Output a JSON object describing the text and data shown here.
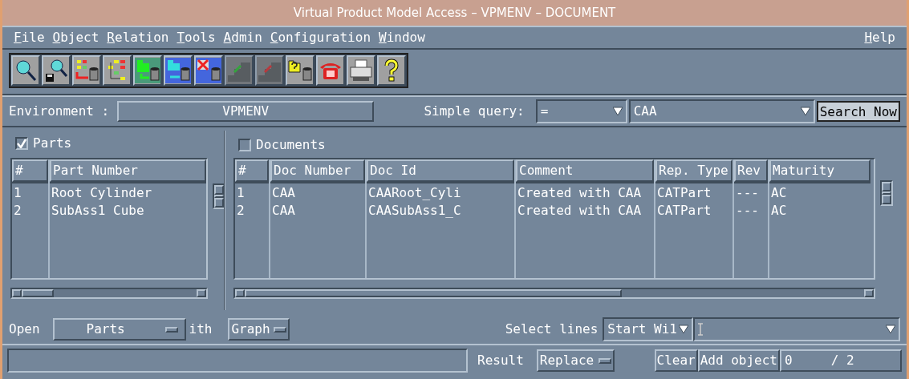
{
  "window": {
    "title": "Virtual Product Model Access – VPMENV – DOCUMENT"
  },
  "menu": [
    {
      "label": "File"
    },
    {
      "label": "Object"
    },
    {
      "label": "Relation"
    },
    {
      "label": "Tools"
    },
    {
      "label": "Admin"
    },
    {
      "label": "Configuration"
    },
    {
      "label": "Window"
    }
  ],
  "help_menu": {
    "label": "Help"
  },
  "toolbar": [
    {
      "kind": "search",
      "disabled": false
    },
    {
      "kind": "search-save",
      "disabled": false
    },
    {
      "kind": "tree-db",
      "disabled": false
    },
    {
      "kind": "tree",
      "disabled": false
    },
    {
      "kind": "green-db",
      "disabled": false
    },
    {
      "kind": "blue-db",
      "disabled": false
    },
    {
      "kind": "delete-db",
      "disabled": false
    },
    {
      "kind": "stairs-up",
      "disabled": true
    },
    {
      "kind": "stairs-down",
      "disabled": true
    },
    {
      "kind": "query-db",
      "disabled": false
    },
    {
      "kind": "phone",
      "disabled": false
    },
    {
      "kind": "printer",
      "disabled": false
    },
    {
      "kind": "help",
      "disabled": false
    }
  ],
  "environment": {
    "label": "Environment :",
    "value": "VPMENV"
  },
  "query": {
    "label": "Simple query:",
    "operator": "=",
    "value": "CAA",
    "button": "Search Now"
  },
  "parts": {
    "label": "Parts",
    "checked": true,
    "columns": [
      "#",
      "Part Number"
    ],
    "rows": [
      [
        "1",
        "Root Cylinder"
      ],
      [
        "2",
        "SubAss1 Cube"
      ]
    ]
  },
  "documents": {
    "label": "Documents",
    "checked": false,
    "columns": [
      "#",
      "Doc Number",
      "Doc Id",
      "Comment",
      "Rep. Type",
      "Rev",
      "Maturity"
    ],
    "rows": [
      [
        "1",
        "CAA",
        "CAARoot_Cyli",
        "Created with CAA",
        "CATPart",
        "---",
        "AC"
      ],
      [
        "2",
        "CAA",
        "CAASubAss1_C",
        "Created with CAA",
        "CATPart",
        "---",
        "AC"
      ]
    ]
  },
  "open_row": {
    "label": "Open",
    "object": "Parts",
    "with_label": "ith",
    "viewer": "Graph"
  },
  "select_lines": {
    "label": "Select lines",
    "mode": "Start Wi1"
  },
  "status_bar": {
    "result_label": "Result",
    "result_mode": "Replace",
    "clear": "Clear",
    "add_object": "Add object",
    "count": "0",
    "total": "/ 2"
  }
}
